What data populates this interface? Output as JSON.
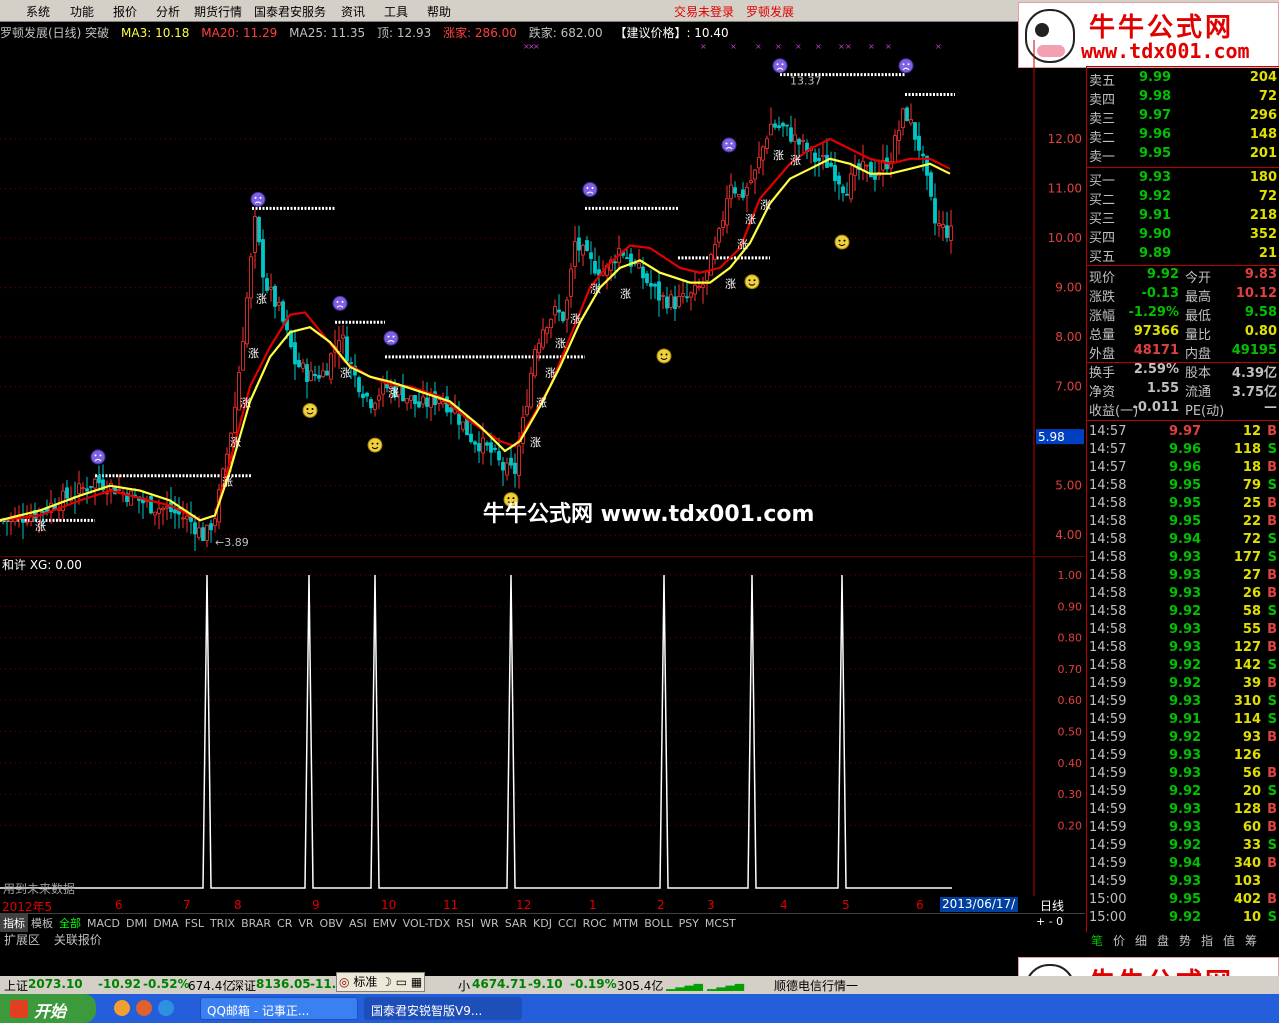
{
  "menubar": {
    "items": [
      "系统",
      "功能",
      "报价",
      "分析",
      "期货行情",
      "国泰君安服务",
      "资讯",
      "工具",
      "帮助"
    ],
    "trade_status": "交易未登录",
    "stock_name": "罗顿发展"
  },
  "logo": {
    "title": "牛牛公式网",
    "url": "www.tdx001.com"
  },
  "infobar": {
    "title": "罗顿发展(日线) 突破",
    "ma3": "MA3: 10.18",
    "ma20": "MA20: 11.29",
    "ma25": "MA25: 11.35",
    "top": "顶: 12.93",
    "up": "涨家: 286.00",
    "down": "跌家: 682.00",
    "advice": "【建议价格】: 10.40"
  },
  "colors": {
    "up": "#ff3030",
    "down": "#00c8c8",
    "ma_red": "#e00000",
    "ma_yellow": "#ffff40",
    "grid": "#800000",
    "accent_green": "#00c000"
  },
  "chart_data": {
    "type": "candlestick",
    "title": "罗顿发展(日线) 突破",
    "y_ticks": [
      "12.00",
      "11.00",
      "10.00",
      "9.00",
      "8.00",
      "7.00",
      "6.00",
      "5.00",
      "4.00"
    ],
    "y_axis_highlight": "5.98",
    "ylim": [
      3.6,
      14.0
    ],
    "annotations": [
      {
        "label": "13.37"
      },
      {
        "label": "3.89"
      }
    ],
    "signal_text": "涨",
    "watermark": "牛牛公式网 www.tdx001.com",
    "price_path": [
      [
        0,
        4.3
      ],
      [
        20,
        4.35
      ],
      [
        40,
        4.5
      ],
      [
        60,
        4.7
      ],
      [
        80,
        4.9
      ],
      [
        95,
        5.1
      ],
      [
        110,
        5.0
      ],
      [
        130,
        4.8
      ],
      [
        150,
        4.6
      ],
      [
        170,
        4.5
      ],
      [
        190,
        4.3
      ],
      [
        205,
        3.95
      ],
      [
        215,
        4.4
      ],
      [
        225,
        5.4
      ],
      [
        235,
        6.6
      ],
      [
        245,
        8.4
      ],
      [
        255,
        10.3
      ],
      [
        265,
        9.1
      ],
      [
        280,
        8.5
      ],
      [
        295,
        7.5
      ],
      [
        310,
        7.2
      ],
      [
        325,
        7.3
      ],
      [
        340,
        8.1
      ],
      [
        355,
        7.2
      ],
      [
        370,
        6.7
      ],
      [
        385,
        7.0
      ],
      [
        400,
        6.9
      ],
      [
        420,
        6.6
      ],
      [
        440,
        6.8
      ],
      [
        455,
        6.5
      ],
      [
        470,
        6.0
      ],
      [
        490,
        5.7
      ],
      [
        505,
        5.3
      ],
      [
        515,
        5.3
      ],
      [
        525,
        6.5
      ],
      [
        535,
        7.8
      ],
      [
        545,
        8.3
      ],
      [
        555,
        8.5
      ],
      [
        565,
        8.4
      ],
      [
        575,
        9.9
      ],
      [
        590,
        9.5
      ],
      [
        605,
        9.3
      ],
      [
        620,
        9.8
      ],
      [
        640,
        9.3
      ],
      [
        660,
        8.8
      ],
      [
        675,
        8.7
      ],
      [
        690,
        8.8
      ],
      [
        705,
        9.1
      ],
      [
        720,
        10.1
      ],
      [
        730,
        11.2
      ],
      [
        740,
        10.8
      ],
      [
        755,
        11.3
      ],
      [
        770,
        12.3
      ],
      [
        785,
        12.2
      ],
      [
        800,
        11.9
      ],
      [
        815,
        11.6
      ],
      [
        830,
        11.5
      ],
      [
        845,
        11.0
      ],
      [
        860,
        11.4
      ],
      [
        875,
        11.3
      ],
      [
        890,
        11.6
      ],
      [
        905,
        12.6
      ],
      [
        920,
        11.8
      ],
      [
        935,
        10.3
      ],
      [
        950,
        10.1
      ]
    ],
    "ma_red": [
      [
        0,
        4.3
      ],
      [
        40,
        4.4
      ],
      [
        80,
        4.7
      ],
      [
        110,
        4.9
      ],
      [
        140,
        4.75
      ],
      [
        170,
        4.6
      ],
      [
        200,
        4.3
      ],
      [
        215,
        4.4
      ],
      [
        230,
        5.5
      ],
      [
        250,
        7.0
      ],
      [
        270,
        7.8
      ],
      [
        290,
        8.45
      ],
      [
        305,
        8.5
      ],
      [
        325,
        8.0
      ],
      [
        345,
        7.5
      ],
      [
        370,
        7.2
      ],
      [
        390,
        7.05
      ],
      [
        410,
        7.0
      ],
      [
        440,
        6.8
      ],
      [
        470,
        6.3
      ],
      [
        500,
        5.9
      ],
      [
        515,
        5.8
      ],
      [
        530,
        6.3
      ],
      [
        550,
        7.0
      ],
      [
        570,
        8.0
      ],
      [
        590,
        9.0
      ],
      [
        610,
        9.5
      ],
      [
        630,
        9.85
      ],
      [
        650,
        9.8
      ],
      [
        680,
        9.4
      ],
      [
        700,
        9.3
      ],
      [
        720,
        9.4
      ],
      [
        740,
        9.8
      ],
      [
        760,
        10.8
      ],
      [
        790,
        11.5
      ],
      [
        810,
        11.8
      ],
      [
        830,
        12.0
      ],
      [
        850,
        11.8
      ],
      [
        870,
        11.6
      ],
      [
        890,
        11.5
      ],
      [
        910,
        11.6
      ],
      [
        930,
        11.6
      ],
      [
        950,
        11.4
      ]
    ],
    "ma_yellow": [
      [
        0,
        4.3
      ],
      [
        40,
        4.5
      ],
      [
        80,
        4.8
      ],
      [
        110,
        5.0
      ],
      [
        140,
        4.9
      ],
      [
        170,
        4.7
      ],
      [
        200,
        4.3
      ],
      [
        215,
        4.4
      ],
      [
        230,
        5.3
      ],
      [
        250,
        6.7
      ],
      [
        270,
        7.6
      ],
      [
        290,
        8.1
      ],
      [
        310,
        8.2
      ],
      [
        330,
        7.9
      ],
      [
        350,
        7.4
      ],
      [
        370,
        7.2
      ],
      [
        390,
        7.1
      ],
      [
        420,
        6.9
      ],
      [
        450,
        6.7
      ],
      [
        480,
        6.2
      ],
      [
        505,
        5.7
      ],
      [
        520,
        5.9
      ],
      [
        540,
        6.6
      ],
      [
        560,
        7.4
      ],
      [
        580,
        8.3
      ],
      [
        600,
        9.0
      ],
      [
        620,
        9.4
      ],
      [
        640,
        9.55
      ],
      [
        660,
        9.3
      ],
      [
        690,
        9.1
      ],
      [
        710,
        9.1
      ],
      [
        730,
        9.4
      ],
      [
        750,
        9.9
      ],
      [
        770,
        10.7
      ],
      [
        790,
        11.2
      ],
      [
        810,
        11.4
      ],
      [
        830,
        11.6
      ],
      [
        850,
        11.5
      ],
      [
        870,
        11.3
      ],
      [
        890,
        11.3
      ],
      [
        910,
        11.4
      ],
      [
        930,
        11.5
      ],
      [
        950,
        11.3
      ]
    ],
    "resistance_lines": [
      {
        "level": 4.3
      },
      {
        "level": 5.2
      },
      {
        "level": 10.6
      },
      {
        "level": 8.3
      },
      {
        "level": 7.6
      },
      {
        "level": 10.6
      },
      {
        "level": 9.6
      },
      {
        "level": 13.3
      },
      {
        "level": 12.9
      }
    ],
    "indicator": {
      "label": "和许 XG: 0.00",
      "y_ticks": [
        "1.00",
        "0.90",
        "0.80",
        "0.70",
        "0.60",
        "0.50",
        "0.40",
        "0.30",
        "0.20"
      ],
      "spike_count": 10
    },
    "date_labels": [
      "2012年5",
      "6",
      "7",
      "8",
      "9",
      "10",
      "11",
      "12",
      "1",
      "2",
      "3",
      "4",
      "5",
      "6"
    ]
  },
  "future_note": "用到未来数据",
  "current_date": "2013/06/17/一",
  "period": "日线",
  "indicator_tabs": [
    "指标",
    "模板",
    "全部",
    "MACD",
    "DMI",
    "DMA",
    "FSL",
    "TRIX",
    "BRAR",
    "CR",
    "VR",
    "OBV",
    "ASI",
    "EMV",
    "VOL-TDX",
    "RSI",
    "WR",
    "SAR",
    "KDJ",
    "CCI",
    "ROC",
    "MTM",
    "BOLL",
    "PSY",
    "MCST"
  ],
  "tab_controls": "+ - 0",
  "expand_tabs": [
    "扩展区",
    "关联报价"
  ],
  "quote": {
    "sell": [
      {
        "label": "卖五",
        "price": "9.99",
        "vol": "204"
      },
      {
        "label": "卖四",
        "price": "9.98",
        "vol": "72"
      },
      {
        "label": "卖三",
        "price": "9.97",
        "vol": "296"
      },
      {
        "label": "卖二",
        "price": "9.96",
        "vol": "148"
      },
      {
        "label": "卖一",
        "price": "9.95",
        "vol": "201"
      }
    ],
    "buy": [
      {
        "label": "买一",
        "price": "9.93",
        "vol": "180"
      },
      {
        "label": "买二",
        "price": "9.92",
        "vol": "72"
      },
      {
        "label": "买三",
        "price": "9.91",
        "vol": "218"
      },
      {
        "label": "买四",
        "price": "9.90",
        "vol": "352"
      },
      {
        "label": "买五",
        "price": "9.89",
        "vol": "21"
      }
    ]
  },
  "stats": [
    {
      "l1": "现价",
      "v1": "9.92",
      "l2": "今开",
      "v2": "9.83"
    },
    {
      "l1": "涨跌",
      "v1": "-0.13",
      "l2": "最高",
      "v2": "10.12"
    },
    {
      "l1": "涨幅",
      "v1": "-1.29%",
      "l2": "最低",
      "v2": "9.58"
    },
    {
      "l1": "总量",
      "v1": "97366",
      "l2": "量比",
      "v2": "0.80"
    },
    {
      "l1": "外盘",
      "v1": "48171",
      "l2": "内盘",
      "v2": "49195"
    },
    {
      "l1": "换手",
      "v1": "2.59%",
      "l2": "股本",
      "v2": "4.39亿"
    },
    {
      "l1": "净资",
      "v1": "1.55",
      "l2": "流通",
      "v2": "3.75亿"
    },
    {
      "l1": "收益(一)",
      "v1": "-0.011",
      "l2": "PE(动)",
      "v2": "—"
    }
  ],
  "ticks": [
    {
      "t": "14:57",
      "p": "9.97",
      "v": "12",
      "d": "B"
    },
    {
      "t": "14:57",
      "p": "9.96",
      "v": "118",
      "d": "S"
    },
    {
      "t": "14:57",
      "p": "9.96",
      "v": "18",
      "d": "B"
    },
    {
      "t": "14:58",
      "p": "9.95",
      "v": "79",
      "d": "S"
    },
    {
      "t": "14:58",
      "p": "9.95",
      "v": "25",
      "d": "B"
    },
    {
      "t": "14:58",
      "p": "9.95",
      "v": "22",
      "d": "B"
    },
    {
      "t": "14:58",
      "p": "9.94",
      "v": "72",
      "d": "S"
    },
    {
      "t": "14:58",
      "p": "9.93",
      "v": "177",
      "d": "S"
    },
    {
      "t": "14:58",
      "p": "9.93",
      "v": "27",
      "d": "B"
    },
    {
      "t": "14:58",
      "p": "9.93",
      "v": "26",
      "d": "B"
    },
    {
      "t": "14:58",
      "p": "9.92",
      "v": "58",
      "d": "S"
    },
    {
      "t": "14:58",
      "p": "9.93",
      "v": "55",
      "d": "B"
    },
    {
      "t": "14:58",
      "p": "9.93",
      "v": "127",
      "d": "B"
    },
    {
      "t": "14:58",
      "p": "9.92",
      "v": "142",
      "d": "S"
    },
    {
      "t": "14:59",
      "p": "9.92",
      "v": "39",
      "d": "B"
    },
    {
      "t": "14:59",
      "p": "9.93",
      "v": "310",
      "d": "S"
    },
    {
      "t": "14:59",
      "p": "9.91",
      "v": "114",
      "d": "S"
    },
    {
      "t": "14:59",
      "p": "9.92",
      "v": "93",
      "d": "B"
    },
    {
      "t": "14:59",
      "p": "9.93",
      "v": "126",
      "d": ""
    },
    {
      "t": "14:59",
      "p": "9.93",
      "v": "56",
      "d": "B"
    },
    {
      "t": "14:59",
      "p": "9.92",
      "v": "20",
      "d": "S"
    },
    {
      "t": "14:59",
      "p": "9.93",
      "v": "128",
      "d": "B"
    },
    {
      "t": "14:59",
      "p": "9.93",
      "v": "60",
      "d": "B"
    },
    {
      "t": "14:59",
      "p": "9.92",
      "v": "33",
      "d": "S"
    },
    {
      "t": "14:59",
      "p": "9.94",
      "v": "340",
      "d": "B"
    },
    {
      "t": "14:59",
      "p": "9.93",
      "v": "103",
      "d": ""
    },
    {
      "t": "15:00",
      "p": "9.95",
      "v": "402",
      "d": "B"
    },
    {
      "t": "15:00",
      "p": "9.92",
      "v": "10",
      "d": "S"
    }
  ],
  "bottom_tabs": [
    "笔",
    "价",
    "细",
    "盘",
    "势",
    "指",
    "值",
    "筹"
  ],
  "statusbar": {
    "sh_label": "上证",
    "sh_value": "2073.10",
    "sh_change": "-10.92",
    "sh_pct": "-0.52%",
    "sh_amount": "674.4亿",
    "sz_label": "深证",
    "sz_value": "8136.05",
    "sz_change": "-11.",
    "mode_btn": "标准",
    "small_label": "小",
    "small_value": "4674.71",
    "small_change": "-9.10",
    "small_pct": "-0.19%",
    "small_amount": "305.4亿",
    "server": "顺德电信行情一"
  },
  "taskbar": {
    "start": "开始",
    "tasks": [
      "QQ邮箱 - 记事正...",
      "国泰君安锐智版V9..."
    ]
  }
}
